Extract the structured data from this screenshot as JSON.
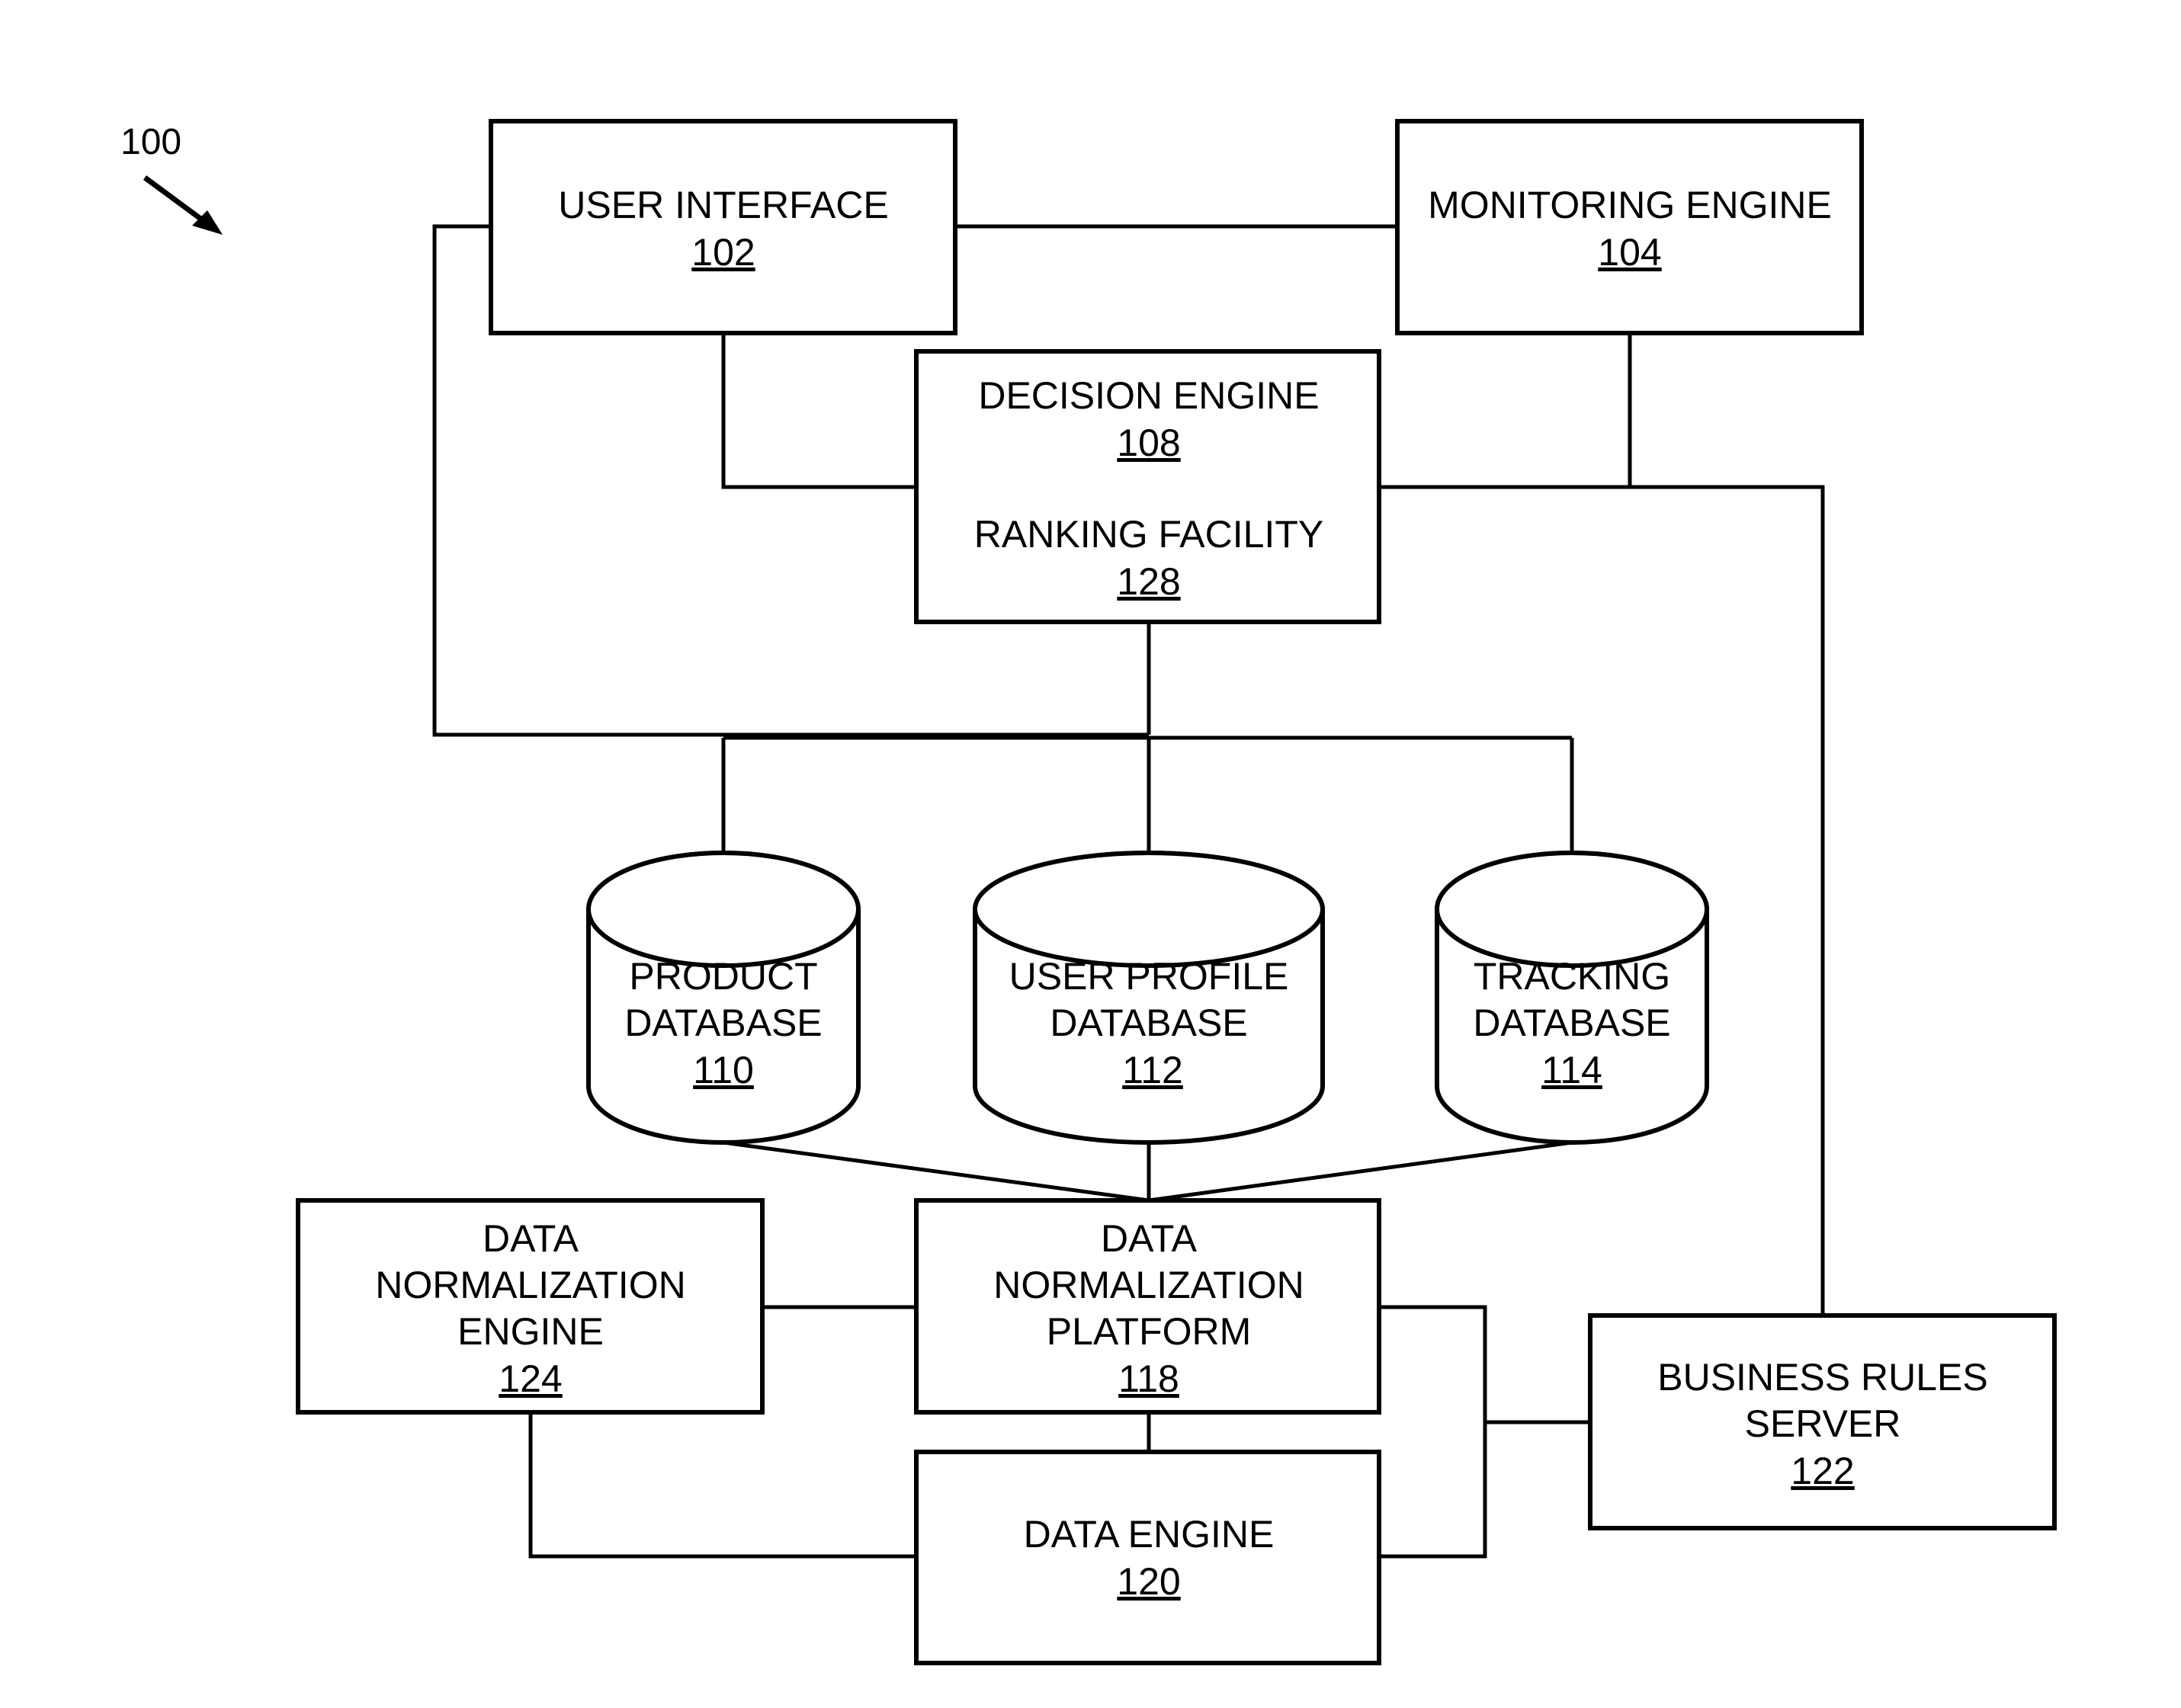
{
  "figure": {
    "reference_number": "100",
    "indicator_icon": "arrow-down-right-icon"
  },
  "components": {
    "user_interface": {
      "lines": [
        "USER INTERFACE"
      ],
      "number": "102"
    },
    "monitoring_engine": {
      "lines": [
        "MONITORING ENGINE"
      ],
      "number": "104"
    },
    "decision_engine": {
      "lines": [
        "DECISION ENGINE"
      ],
      "number": "108"
    },
    "ranking_facility": {
      "lines": [
        "RANKING FACILITY"
      ],
      "number": "128"
    },
    "product_database": {
      "lines": [
        "PRODUCT",
        "DATABASE"
      ],
      "number": "110"
    },
    "user_profile_database": {
      "lines": [
        "USER PROFILE",
        "DATABASE"
      ],
      "number": "112"
    },
    "tracking_database": {
      "lines": [
        "TRACKING",
        "DATABASE"
      ],
      "number": "114"
    },
    "data_normalization_engine": {
      "lines": [
        "DATA",
        "NORMALIZATION",
        "ENGINE"
      ],
      "number": "124"
    },
    "data_normalization_platform": {
      "lines": [
        "DATA",
        "NORMALIZATION",
        "PLATFORM"
      ],
      "number": "118"
    },
    "data_engine": {
      "lines": [
        "DATA ENGINE"
      ],
      "number": "120"
    },
    "business_rules_server": {
      "lines": [
        "BUSINESS RULES",
        "SERVER"
      ],
      "number": "122"
    }
  },
  "connections": [
    [
      "user_interface",
      "monitoring_engine"
    ],
    [
      "user_interface",
      "decision_engine"
    ],
    [
      "monitoring_engine",
      "business_rules_server"
    ],
    [
      "decision_engine",
      "business_rules_server"
    ],
    [
      "user_interface",
      "database_bus"
    ],
    [
      "decision_engine",
      "database_bus"
    ],
    [
      "database_bus",
      "product_database"
    ],
    [
      "database_bus",
      "user_profile_database"
    ],
    [
      "database_bus",
      "tracking_database"
    ],
    [
      "product_database",
      "data_normalization_platform"
    ],
    [
      "user_profile_database",
      "data_normalization_platform"
    ],
    [
      "tracking_database",
      "data_normalization_platform"
    ],
    [
      "data_normalization_engine",
      "data_normalization_platform"
    ],
    [
      "data_normalization_engine",
      "data_engine"
    ],
    [
      "data_normalization_platform",
      "data_engine"
    ],
    [
      "data_normalization_platform",
      "business_rules_server"
    ],
    [
      "data_engine",
      "business_rules_server"
    ]
  ]
}
